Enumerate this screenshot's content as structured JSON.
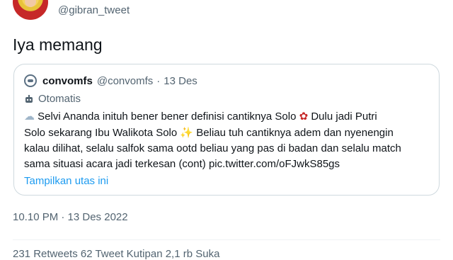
{
  "tweet": {
    "handle": "@gibran_tweet",
    "text": "Iya memang",
    "timestamp": "10.10 PM · 13 Des 2022"
  },
  "quote": {
    "name": "convomfs",
    "handle": "@convomfs",
    "date_sep": "·",
    "date": "13 Des",
    "label": "Otomatis",
    "body_line1": "Selvi Ananda inituh bener bener definisi cantiknya Solo",
    "body_line1b": "Dulu jadi Putri",
    "body_line2": "Solo sekarang Ibu Walikota Solo",
    "body_line2b": "Beliau tuh cantiknya adem dan nyenengin",
    "body_line3": "kalau dilihat, selalu salfok sama ootd beliau yang pas di badan dan selalu match",
    "body_line4": "sama situasi acara jadi terkesan (cont) pic.twitter.com/oFJwkS85gs",
    "thread_link": "Tampilkan utas ini"
  },
  "stats": {
    "partial": "231 Retweets   62 Tweet Kutipan   2,1 rb Suka"
  },
  "icons": {
    "bubble": "thought-bubble-icon",
    "rose": "rose-icon",
    "sparkle": "sparkles-icon",
    "robot": "robot-icon"
  }
}
